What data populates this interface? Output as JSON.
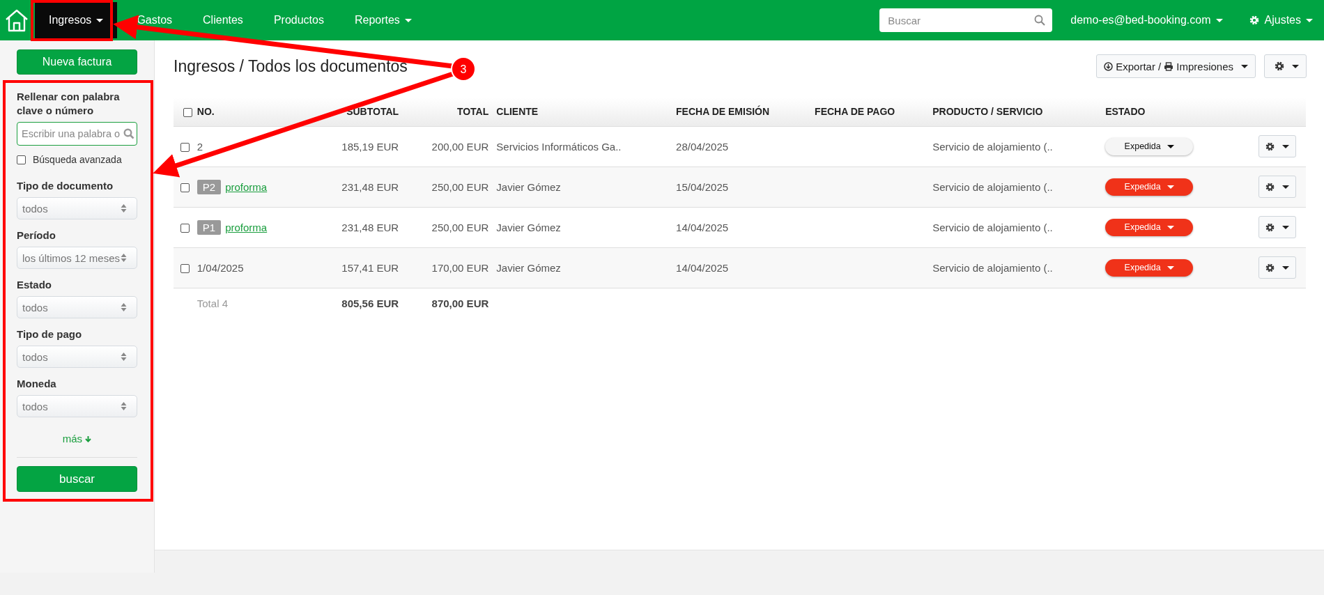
{
  "nav": {
    "items": [
      {
        "label": "Ingresos",
        "selected": true,
        "dropdown": true
      },
      {
        "label": "Gastos",
        "selected": false,
        "dropdown": false
      },
      {
        "label": "Clientes",
        "selected": false,
        "dropdown": false
      },
      {
        "label": "Productos",
        "selected": false,
        "dropdown": false
      },
      {
        "label": "Reportes",
        "selected": false,
        "dropdown": true
      }
    ],
    "search": {
      "placeholder": "Buscar"
    },
    "account": "demo-es@bed-booking.com",
    "settings": "Ajustes"
  },
  "sidebar": {
    "new_button": "Nueva factura",
    "keyword": {
      "label": "Rellenar con palabra clave o número",
      "placeholder": "Escribir una palabra o"
    },
    "advanced": {
      "label": "Búsqueda avanzada",
      "checked": false
    },
    "filters": [
      {
        "label": "Tipo de documento",
        "value": "todos"
      },
      {
        "label": "Período",
        "value": "los últimos 12 meses"
      },
      {
        "label": "Estado",
        "value": "todos"
      },
      {
        "label": "Tipo de pago",
        "value": "todos"
      },
      {
        "label": "Moneda",
        "value": "todos"
      }
    ],
    "more": "más",
    "search_button": "buscar"
  },
  "page": {
    "title": "Ingresos / Todos los documentos",
    "export_label": "Exportar /",
    "print_label": "Impresiones"
  },
  "table": {
    "select_all": false,
    "columns": [
      "NO.",
      "SUBTOTAL",
      "TOTAL",
      "CLIENTE",
      "FECHA DE EMISIÓN",
      "FECHA DE PAGO",
      "PRODUCTO / SERVICIO",
      "ESTADO"
    ],
    "rows": [
      {
        "checked": false,
        "number": "2",
        "subtotal": "185,19 EUR",
        "total": "200,00 EUR",
        "client": "Servicios Informáticos Ga..",
        "issued": "28/04/2025",
        "product": "Servicio de alojamiento (..",
        "status": "Expedida",
        "color": "#f5f5f5"
      },
      {
        "checked": false,
        "badge": "P2",
        "link": "proforma",
        "subtotal": "231,48 EUR",
        "total": "250,00 EUR",
        "client": "Javier Gómez",
        "issued": "15/04/2025",
        "product": "Servicio de alojamiento (..",
        "status": "Expedida",
        "color": "#f03219"
      },
      {
        "checked": false,
        "badge": "P1",
        "link": "proforma",
        "subtotal": "231,48 EUR",
        "total": "250,00 EUR",
        "client": "Javier Gómez",
        "issued": "14/04/2025",
        "product": "Servicio de alojamiento (..",
        "status": "Expedida",
        "color": "#f03219"
      },
      {
        "checked": false,
        "number": "1/04/2025",
        "subtotal": "157,41 EUR",
        "total": "170,00 EUR",
        "client": "Javier Gómez",
        "issued": "14/04/2025",
        "product": "Servicio de alojamiento (..",
        "status": "Expedida",
        "color": "#f03219"
      }
    ],
    "total": {
      "label": "Total 4",
      "subtotal": "805,56 EUR",
      "total": "870,00 EUR"
    }
  },
  "annotation": {
    "number": "3"
  }
}
